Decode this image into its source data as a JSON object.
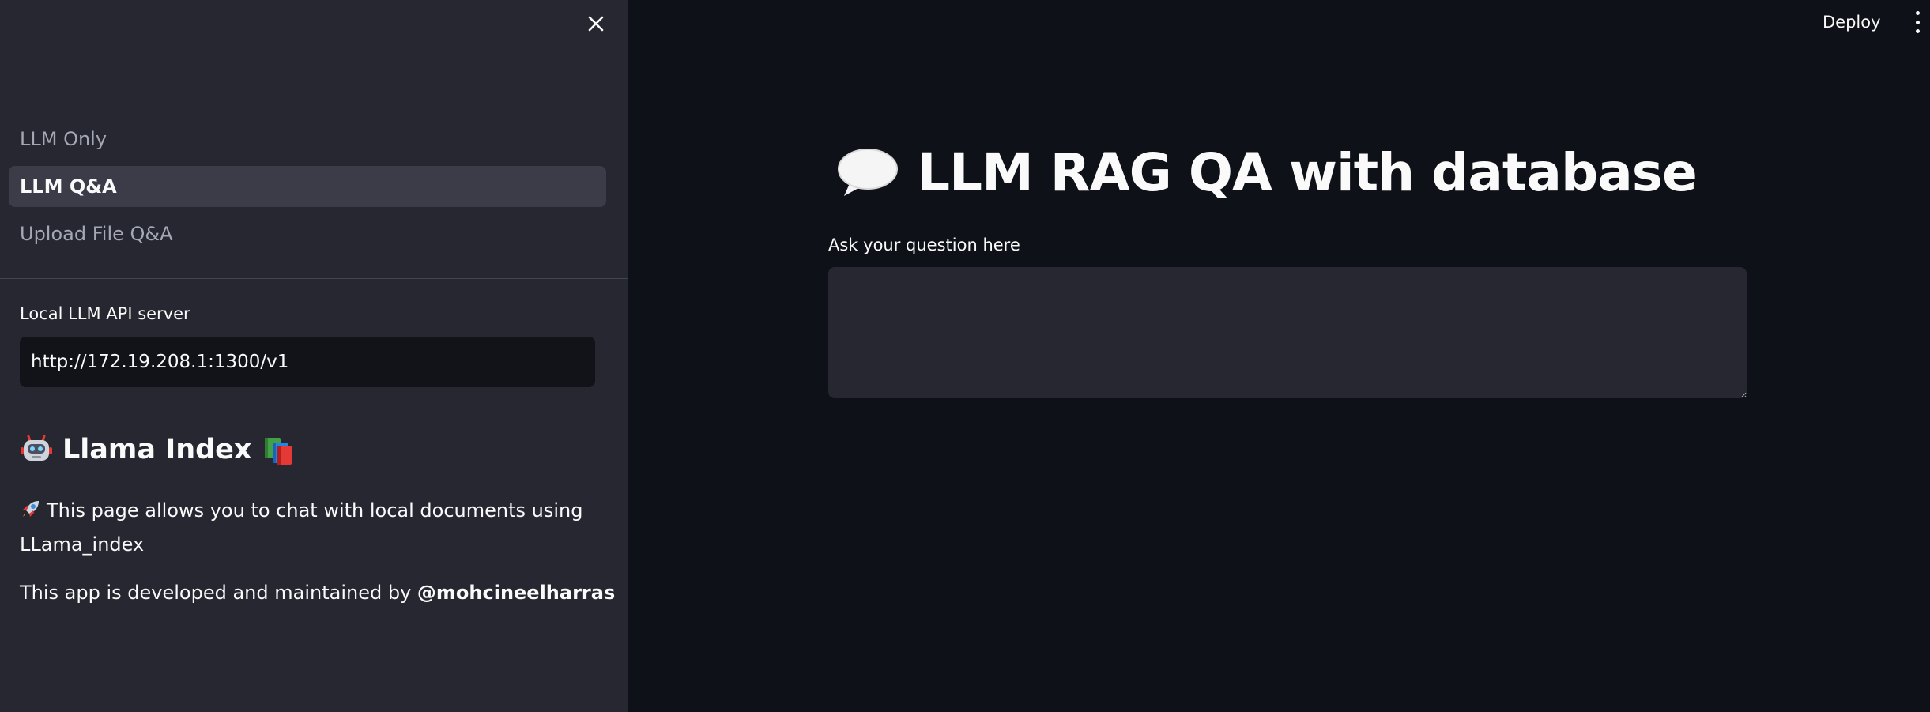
{
  "sidebar": {
    "nav_items": [
      {
        "label": "LLM Only",
        "active": false
      },
      {
        "label": "LLM Q&A",
        "active": true
      },
      {
        "label": "Upload File Q&A",
        "active": false
      }
    ],
    "api_label": "Local LLM API server",
    "api_value": "http://172.19.208.1:1300/v1",
    "heading": "Llama Index",
    "description": "This page allows you to chat with local documents using LLama_index",
    "credit_prefix": "This app is developed and maintained by ",
    "credit_handle": "@mohcineelharras"
  },
  "header": {
    "deploy_label": "Deploy"
  },
  "main": {
    "title": "LLM RAG QA with database",
    "question_label": "Ask your question here",
    "question_value": ""
  },
  "colors": {
    "sidebar_bg": "#262730",
    "main_bg": "#0e1117",
    "active_nav_bg": "#3b3c48",
    "input_bg": "#111319",
    "textarea_bg": "#262730",
    "text": "#fafafa",
    "muted_text": "#a3a8b4"
  },
  "icons": {
    "close": "close-icon",
    "menu": "kebab-menu-icon",
    "robot": "robot-emoji-icon",
    "books": "books-emoji-icon",
    "rocket": "rocket-emoji-icon",
    "speech": "speech-balloon-icon"
  }
}
